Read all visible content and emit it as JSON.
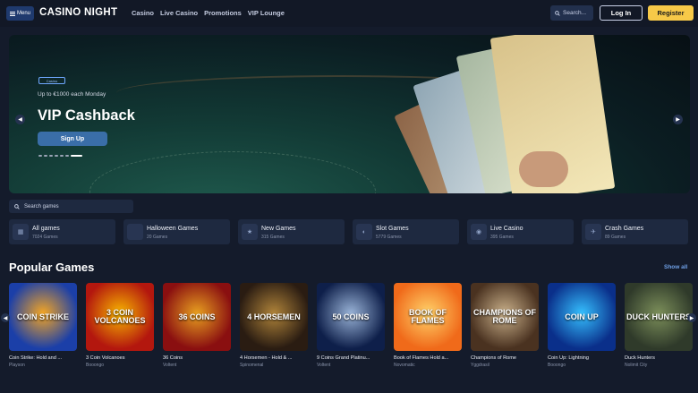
{
  "header": {
    "menu_label": "Menu",
    "logo": "CASINO NIGHT",
    "nav": [
      "Casino",
      "Live Casino",
      "Promotions",
      "VIP Lounge"
    ],
    "search_label": "Search...",
    "login_label": "Log In",
    "register_label": "Register"
  },
  "hero": {
    "badge": "Casino",
    "subtitle": "Up to €1000 each Monday",
    "title": "VIP Cashback",
    "cta": "Sign Up",
    "slides": 7,
    "active_slide": 7
  },
  "games_search": {
    "placeholder": "Search games"
  },
  "categories": [
    {
      "name": "All games",
      "count": "7024 Games",
      "icon": "grid-icon"
    },
    {
      "name": "Halloween Games",
      "count": "20 Games",
      "icon": "pumpkin-icon"
    },
    {
      "name": "New Games",
      "count": "315 Games",
      "icon": "star-icon"
    },
    {
      "name": "Slot Games",
      "count": "5779 Games",
      "icon": "slot-icon"
    },
    {
      "name": "Live Casino",
      "count": "395 Games",
      "icon": "chips-icon"
    },
    {
      "name": "Crash Games",
      "count": "89 Games",
      "icon": "plane-icon"
    }
  ],
  "popular": {
    "title": "Popular Games",
    "show_all": "Show all",
    "games": [
      {
        "name": "Coin Strike: Hold and ...",
        "provider": "Playson",
        "thumb_text": "COIN STRIKE",
        "color_a": "#1b3fa8",
        "color_b": "#f5a623"
      },
      {
        "name": "3 Coin Volcanoes",
        "provider": "Booongo",
        "thumb_text": "3 COIN VOLCANOES",
        "color_a": "#b3170e",
        "color_b": "#f7b500"
      },
      {
        "name": "36 Coins",
        "provider": "Voltent",
        "thumb_text": "36 COINS",
        "color_a": "#8a0f10",
        "color_b": "#e8a020"
      },
      {
        "name": "4 Horsemen - Hold & ...",
        "provider": "Spinomenal",
        "thumb_text": "4 HORSEMEN",
        "color_a": "#2a1c12",
        "color_b": "#b0843a"
      },
      {
        "name": "9 Coins Grand Platinu...",
        "provider": "Voltent",
        "thumb_text": "50 COINS",
        "color_a": "#0e1f4a",
        "color_b": "#9ab4d8"
      },
      {
        "name": "Book of Flames Hold a...",
        "provider": "Novomatic",
        "thumb_text": "BOOK OF FLAMES",
        "color_a": "#f06a1a",
        "color_b": "#ffd36a"
      },
      {
        "name": "Champions of Rome",
        "provider": "Yggdrasil",
        "thumb_text": "CHAMPIONS OF ROME",
        "color_a": "#4a3220",
        "color_b": "#c9b08a"
      },
      {
        "name": "Coin Up: Lightning",
        "provider": "Booongo",
        "thumb_text": "COIN UP",
        "color_a": "#0a2f8a",
        "color_b": "#35c0ff"
      },
      {
        "name": "Duck Hunters",
        "provider": "Nolimit City",
        "thumb_text": "DUCK HUNTERS",
        "color_a": "#2f3a2a",
        "color_b": "#7c8f5a"
      }
    ]
  }
}
